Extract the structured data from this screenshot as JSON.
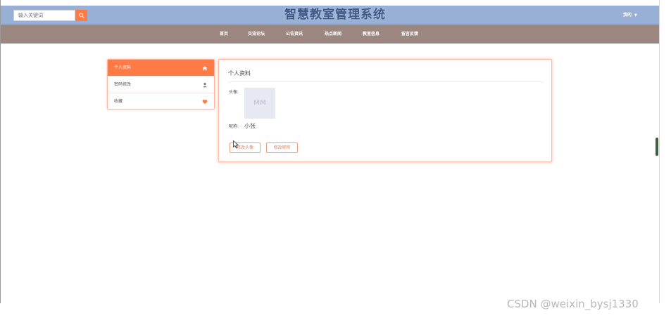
{
  "header": {
    "search": {
      "placeholder": "输入关键词"
    },
    "site_title": "智慧教室管理系统",
    "user_menu": {
      "label": "我的",
      "caret": "▼"
    }
  },
  "nav": {
    "items": [
      "首页",
      "交流论坛",
      "公告资讯",
      "热点新闻",
      "教室信息",
      "留言反馈"
    ]
  },
  "side_menu": {
    "items": [
      {
        "label": "个人资料",
        "icon": "home-icon",
        "active": true
      },
      {
        "label": "密码修改",
        "icon": "user-icon",
        "active": false
      },
      {
        "label": "收藏",
        "icon": "heart-icon",
        "active": false
      }
    ]
  },
  "profile": {
    "title": "个人资料",
    "avatar_label": "头像:",
    "avatar_text": "MM",
    "nickname_label": "昵称:",
    "nickname_value": "小张",
    "change_avatar_button": "修改头像",
    "change_nickname_button": "修改昵称"
  },
  "watermark": "CSDN @weixin_bysj1330",
  "colors": {
    "topbar": "#98b0d6",
    "navbar": "#9c8680",
    "accent": "#ff7a45",
    "title_text": "#3e5784"
  }
}
